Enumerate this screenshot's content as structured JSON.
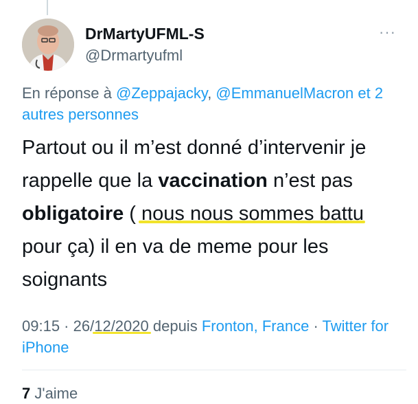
{
  "author": {
    "display_name": "DrMartyUFML-S",
    "handle": "@Drmartyufml"
  },
  "menu_icon": "more-horizontal-icon",
  "reply_context": {
    "prefix": "En réponse à ",
    "mentions": [
      "@Zeppajacky",
      "@EmmanuelMacron"
    ],
    "separator": ", ",
    "suffix": " et 2 autres personnes"
  },
  "tweet": {
    "part1": "Partout ou il m’est donné d’intervenir je rappelle que la ",
    "bold1": "vaccination",
    "part2": " n’est pas ",
    "bold2": "obligatoire",
    "part3": " ( ",
    "highlighted": "nous nous sommes battu",
    "part4": " pour ça) il en va de meme pour les soignants"
  },
  "meta": {
    "time": "09:15",
    "dot": " · ",
    "date_prefix": "26/",
    "date_highlight": "12/2020",
    "via": " depuis ",
    "location": "Fronton, France",
    "dot2": " · ",
    "client": "Twitter for iPhone"
  },
  "likes": {
    "count": "7",
    "label": " J'aime"
  },
  "colors": {
    "link": "#1d9bf0",
    "secondary_text": "#536471",
    "highlight": "#f2e32a"
  }
}
